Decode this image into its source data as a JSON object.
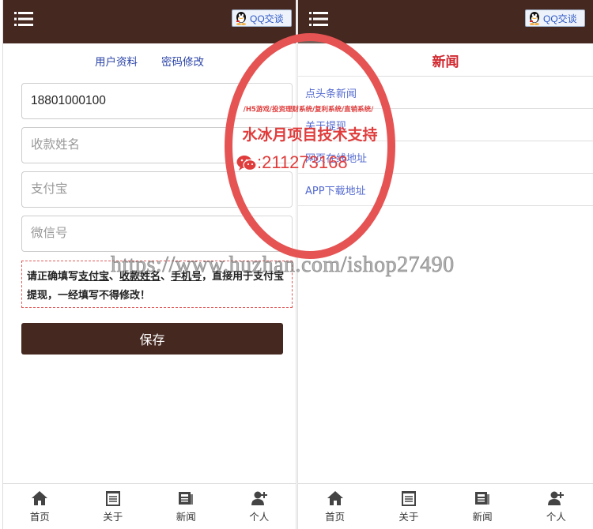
{
  "left_screen": {
    "qq_button_label": "QQ交谈",
    "tabs": [
      {
        "label": "用户资料"
      },
      {
        "label": "密码修改"
      }
    ],
    "form": {
      "phone_value": "18801000100",
      "name_placeholder": "收款姓名",
      "alipay_placeholder": "支付宝",
      "wechat_placeholder": "微信号"
    },
    "notice": {
      "part1": "请正确填写",
      "alipay": "支付宝",
      "sep1": "、",
      "name": "收款姓名",
      "sep2": "、",
      "phone": "手机号",
      "part2": "，直接用于支付宝提现，一经填写不得修改！"
    },
    "save_label": "保存"
  },
  "right_screen": {
    "qq_button_label": "QQ交谈",
    "title": "新闻",
    "news": [
      {
        "label": "点头条新闻"
      },
      {
        "label": "关于提现"
      },
      {
        "label": "网页在线地址"
      },
      {
        "label": "APP下载地址"
      }
    ]
  },
  "footer": [
    {
      "label": "首页",
      "icon": "home-icon"
    },
    {
      "label": "关于",
      "icon": "about-icon"
    },
    {
      "label": "新闻",
      "icon": "news-icon"
    },
    {
      "label": "个人",
      "icon": "user-add-icon"
    }
  ],
  "watermark": {
    "stamp_line1": "/H5游戏/投资理财系统/复利系统/直销系统/",
    "stamp_line2": "水冰月项目技术支持",
    "stamp_line3": ":211273168",
    "url": "https://www.huzhan.com/ishop27490"
  },
  "colors": {
    "header": "#452820",
    "accent_red": "#d0282e",
    "link_blue": "#1a38c0",
    "stamp_red": "#e03c3c"
  }
}
